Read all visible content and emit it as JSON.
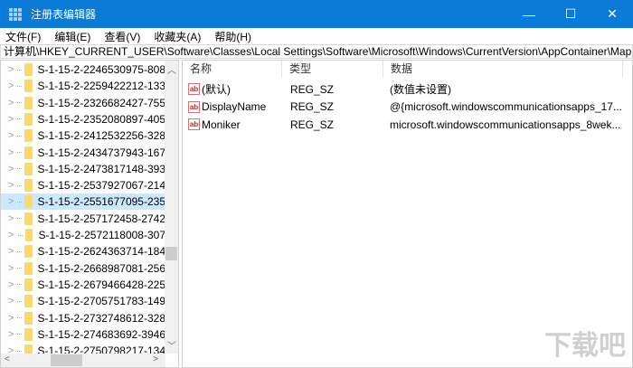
{
  "window": {
    "title": "注册表编辑器",
    "minimize": "—",
    "maximize": "☐",
    "close": "✕"
  },
  "menu": [
    "文件(F)",
    "编辑(E)",
    "查看(V)",
    "收藏夹(A)",
    "帮助(H)"
  ],
  "address": "计算机\\HKEY_CURRENT_USER\\Software\\Classes\\Local Settings\\Software\\Microsoft\\Windows\\CurrentVersion\\AppContainer\\Mappi",
  "tree": {
    "selected_index": 8,
    "items": [
      "S-1-15-2-2246530975-808",
      "S-1-15-2-2259422212-133",
      "S-1-15-2-2326682427-755",
      "S-1-15-2-2352080897-405",
      "S-1-15-2-2412532256-328",
      "S-1-15-2-2434737943-167",
      "S-1-15-2-2473817148-393",
      "S-1-15-2-2537927067-214",
      "S-1-15-2-2551677095-235",
      "S-1-15-2-257172458-2742",
      "S-1-15-2-2572118008-307",
      "S-1-15-2-2624363714-184",
      "S-1-15-2-2668987081-256",
      "S-1-15-2-2679466428-225",
      "S-1-15-2-2705751783-149",
      "S-1-15-2-2732748612-328",
      "S-1-15-2-274683692-3946",
      "S-1-15-2-2750798217-134"
    ]
  },
  "values": {
    "headers": [
      "名称",
      "类型",
      "数据"
    ],
    "rows": [
      {
        "name": "(默认)",
        "type": "REG_SZ",
        "data": "(数值未设置)"
      },
      {
        "name": "DisplayName",
        "type": "REG_SZ",
        "data": "@{microsoft.windowscommunicationsapps_17..."
      },
      {
        "name": "Moniker",
        "type": "REG_SZ",
        "data": "microsoft.windowscommunicationsapps_8wek..."
      }
    ]
  },
  "value_icon": "ab",
  "watermark": "下载吧"
}
